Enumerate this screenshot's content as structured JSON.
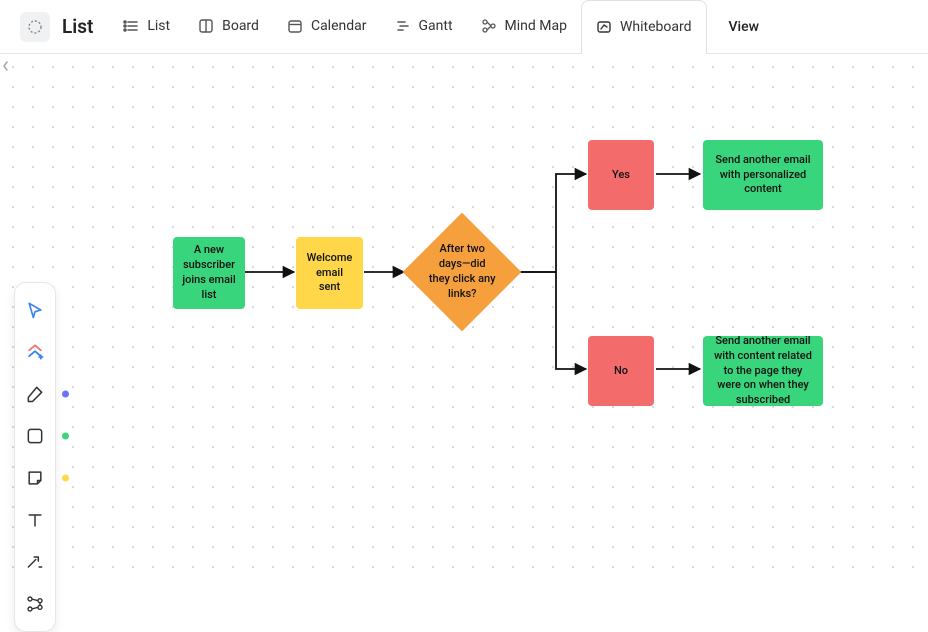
{
  "title": "List",
  "tabs": [
    {
      "id": "list",
      "label": "List"
    },
    {
      "id": "board",
      "label": "Board"
    },
    {
      "id": "calendar",
      "label": "Calendar"
    },
    {
      "id": "gantt",
      "label": "Gantt"
    },
    {
      "id": "mindmap",
      "label": "Mind Map"
    },
    {
      "id": "whiteboard",
      "label": "Whiteboard"
    }
  ],
  "add_view_label": "View",
  "toolbar": {
    "pointer_color": "#3b82f6",
    "ai_colors": [
      "#f87171",
      "#3b82f6"
    ],
    "dot_pen": "#6b72f5",
    "dot_rect": "#38d57c",
    "dot_sticky": "#ffd748"
  },
  "flow": {
    "n1": "A new subscriber joins email list",
    "n2": "Welcome email sent",
    "n3": "After two days—did they click any links?",
    "n4": "Yes",
    "n5": "No",
    "n6": "Send another email with personalized content",
    "n7": "Send another email with content related to the page they were on when they subscribed"
  },
  "chart_data": {
    "type": "flowchart",
    "nodes": [
      {
        "id": "n1",
        "shape": "rect",
        "color": "#38d57c",
        "text": "A new subscriber joins email list"
      },
      {
        "id": "n2",
        "shape": "rect",
        "color": "#ffd748",
        "text": "Welcome email sent"
      },
      {
        "id": "n3",
        "shape": "diamond",
        "color": "#f5a03c",
        "text": "After two days—did they click any links?"
      },
      {
        "id": "n4",
        "shape": "rect",
        "color": "#f46b6b",
        "text": "Yes"
      },
      {
        "id": "n5",
        "shape": "rect",
        "color": "#f46b6b",
        "text": "No"
      },
      {
        "id": "n6",
        "shape": "rect",
        "color": "#38d57c",
        "text": "Send another email with personalized content"
      },
      {
        "id": "n7",
        "shape": "rect",
        "color": "#38d57c",
        "text": "Send another email with content related to the page they were on when they subscribed"
      }
    ],
    "edges": [
      {
        "from": "n1",
        "to": "n2"
      },
      {
        "from": "n2",
        "to": "n3"
      },
      {
        "from": "n3",
        "to": "n4"
      },
      {
        "from": "n3",
        "to": "n5"
      },
      {
        "from": "n4",
        "to": "n6"
      },
      {
        "from": "n5",
        "to": "n7"
      }
    ]
  }
}
